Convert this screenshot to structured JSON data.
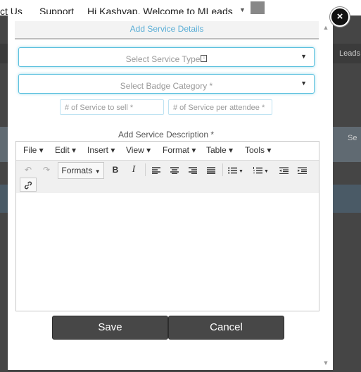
{
  "background": {
    "nav_contact_fragment": "ct Us",
    "nav_support": "Support",
    "nav_greeting": "Hi Kashyap, Welcome to MLeads",
    "side_text_1": "Leads",
    "side_text_2": "Se"
  },
  "modal": {
    "title": "Add Service Details",
    "close_symbol": "×",
    "service_type_placeholder": "Select Service Type",
    "badge_category_placeholder": "Select Badge Category *",
    "services_to_sell_placeholder": "# of Service to sell *",
    "service_per_attendee_placeholder": "# of Service per attendee *",
    "description_label": "Add Service Description *",
    "save_label": "Save",
    "cancel_label": "Cancel"
  },
  "editor": {
    "menus": [
      {
        "label": "File"
      },
      {
        "label": "Edit"
      },
      {
        "label": "Insert"
      },
      {
        "label": "View"
      },
      {
        "label": "Format"
      },
      {
        "label": "Table"
      },
      {
        "label": "Tools"
      }
    ],
    "formats_label": "Formats",
    "bold_label": "B",
    "italic_label": "I"
  },
  "colors": {
    "accent": "#5aaed6",
    "button_bg": "#474747",
    "focus_border": "#5bc0de"
  }
}
